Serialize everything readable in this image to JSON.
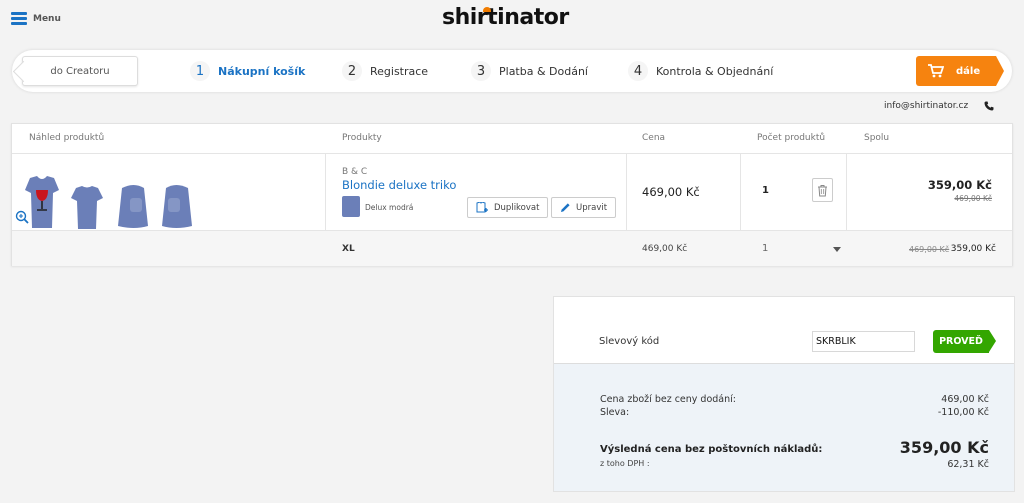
{
  "header": {
    "menu_label": "Menu",
    "logo_text": "shirtinator"
  },
  "stepbar": {
    "back_label": "do Creatoru",
    "steps": [
      {
        "num": "1",
        "label": "Nákupní košík"
      },
      {
        "num": "2",
        "label": "Registrace"
      },
      {
        "num": "3",
        "label": "Platba & Dodání"
      },
      {
        "num": "4",
        "label": "Kontrola & Objednání"
      }
    ],
    "next_label": "dále"
  },
  "contact": {
    "email": "info@shirtinator.cz"
  },
  "cart": {
    "headers": [
      "Náhled produktů",
      "Produkty",
      "Cena",
      "Počet produktů",
      "Spolu"
    ],
    "item": {
      "brand": "B & C",
      "name": "Blondie deluxe triko",
      "color_name": "Delux modrá",
      "duplicate_label": "Duplikovat",
      "edit_label": "Upravit",
      "price": "469,00 Kč",
      "quantity": "1",
      "total": "359,00 Kč",
      "total_old": "469,00 Kč"
    },
    "subrow": {
      "size": "XL",
      "price": "469,00 Kč",
      "quantity": "1",
      "old": "469,00 Kč",
      "total": "359,00 Kč"
    }
  },
  "summary": {
    "discount_label": "Slevový kód",
    "discount_value": "SKRBLIK",
    "apply_label": "PROVEĎ",
    "goods_label": "Cena zboží bez ceny dodání:",
    "goods_value": "469,00 Kč",
    "discount_line_label": "Sleva:",
    "discount_line_value": "-110,00 Kč",
    "final_label": "Výsledná cena bez poštovních nákladů:",
    "final_value": "359,00 Kč",
    "vat_label": "z toho DPH :",
    "vat_value": "62,31 Kč"
  },
  "colors": {
    "accent_blue": "#1b73c4",
    "next_orange": "#f6830f",
    "apply_green": "#33a600",
    "shirt": "#6b7fb8"
  }
}
